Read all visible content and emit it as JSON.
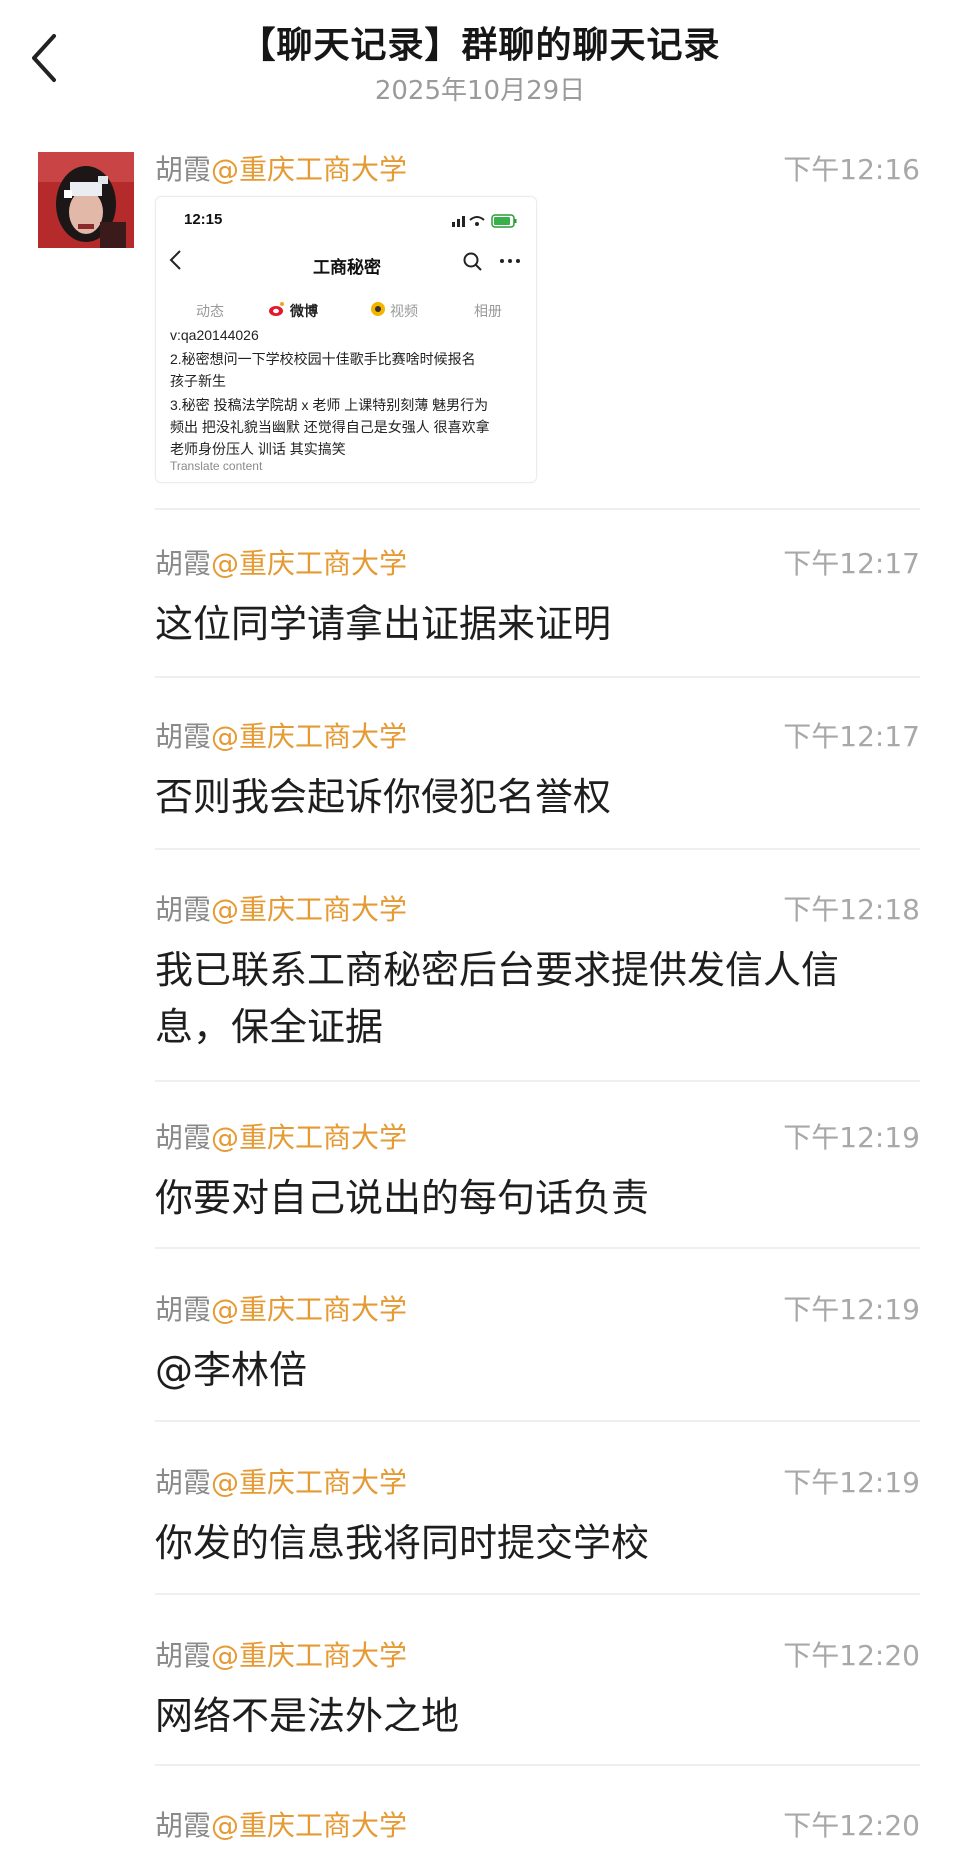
{
  "header": {
    "title": "【聊天记录】群聊的聊天记录",
    "date": "2025年10月29日"
  },
  "screenshot": {
    "clock": "12:15",
    "title": "工商秘密",
    "tabs": [
      "动态",
      "微博",
      "视频",
      "相册"
    ],
    "lines": [
      "v:qa20144026",
      "2.秘密想问一下学校校园十佳歌手比赛啥时候报名",
      "孩子新生",
      "3.秘密 投稿法学院胡 x 老师 上课特别刻薄 魅男行为",
      "频出 把没礼貌当幽默 还觉得自己是女强人 很喜欢拿",
      "老师身份压人 训话 其实搞笑"
    ],
    "translate": "Translate content"
  },
  "messages": [
    {
      "sender": "胡霞",
      "org": "@重庆工商大学",
      "time": "下午12:16",
      "text": ""
    },
    {
      "sender": "胡霞",
      "org": "@重庆工商大学",
      "time": "下午12:17",
      "text": "这位同学请拿出证据来证明"
    },
    {
      "sender": "胡霞",
      "org": "@重庆工商大学",
      "time": "下午12:17",
      "text": "否则我会起诉你侵犯名誉权"
    },
    {
      "sender": "胡霞",
      "org": "@重庆工商大学",
      "time": "下午12:18",
      "text": "我已联系工商秘密后台要求提供发信人信息，保全证据"
    },
    {
      "sender": "胡霞",
      "org": "@重庆工商大学",
      "time": "下午12:19",
      "text": "你要对自己说出的每句话负责"
    },
    {
      "sender": "胡霞",
      "org": "@重庆工商大学",
      "time": "下午12:19",
      "text": "@李林倍"
    },
    {
      "sender": "胡霞",
      "org": "@重庆工商大学",
      "time": "下午12:19",
      "text": "你发的信息我将同时提交学校"
    },
    {
      "sender": "胡霞",
      "org": "@重庆工商大学",
      "time": "下午12:20",
      "text": "网络不是法外之地"
    },
    {
      "sender": "胡霞",
      "org": "@重庆工商大学",
      "time": "下午12:20",
      "text": ""
    }
  ]
}
